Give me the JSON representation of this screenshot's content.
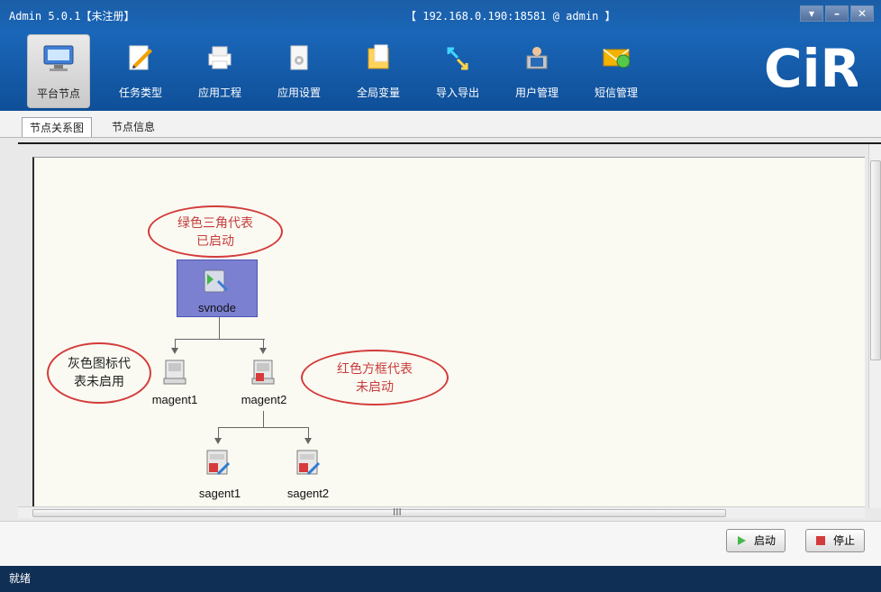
{
  "window": {
    "title_left": "Admin 5.0.1【未注册】",
    "title_center": "【 192.168.0.190:18581 @ admin 】"
  },
  "toolbar": {
    "items": [
      {
        "label": "平台节点",
        "icon": "monitor-icon"
      },
      {
        "label": "任务类型",
        "icon": "edit-document-icon"
      },
      {
        "label": "应用工程",
        "icon": "printer-icon"
      },
      {
        "label": "应用设置",
        "icon": "settings-document-icon"
      },
      {
        "label": "全局变量",
        "icon": "folder-document-icon"
      },
      {
        "label": "导入导出",
        "icon": "import-export-icon"
      },
      {
        "label": "用户管理",
        "icon": "user-management-icon"
      },
      {
        "label": "短信管理",
        "icon": "sms-envelope-icon"
      }
    ]
  },
  "tabs": {
    "active": "节点关系图",
    "other": "节点信息"
  },
  "graph": {
    "root": "svnode",
    "children": [
      "magent1",
      "magent2"
    ],
    "grandchildren": [
      "sagent1",
      "sagent2"
    ]
  },
  "callouts": [
    {
      "text": "绿色三角代表\n已启动"
    },
    {
      "text": "灰色图标代\n表未启用"
    },
    {
      "text": "红色方框代表\n未启动"
    }
  ],
  "buttons": {
    "start": "启动",
    "stop": "停止"
  },
  "status": {
    "text": "就绪"
  },
  "scroll": {
    "h_thumb_label": "III"
  },
  "colors": {
    "title_bar": "#1a66b8",
    "statusbar": "#102f54",
    "callout_red": "#d43b3b",
    "node_box": "#7b80d1"
  }
}
